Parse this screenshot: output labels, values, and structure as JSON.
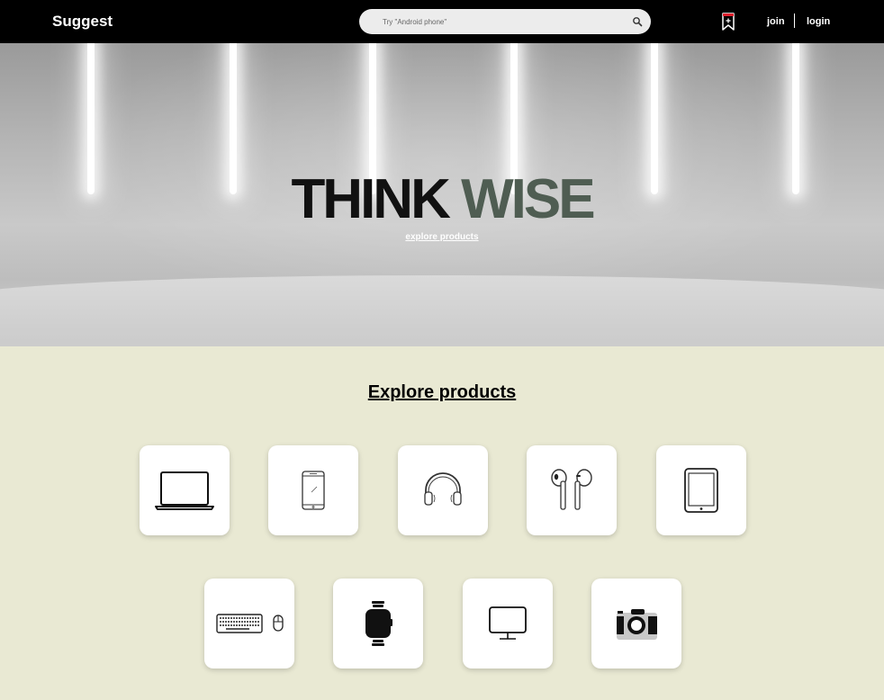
{
  "header": {
    "logo": "Suggest",
    "search": {
      "placeholder": "Try \"Android phone\"",
      "icon": "search-icon"
    },
    "bookmark_icon": "bookmark-icon",
    "join": "join",
    "login": "login"
  },
  "hero": {
    "title_word_1": "THINK",
    "title_word_2": "WISE",
    "link": "explore products",
    "colors": {
      "word_1": "#111111",
      "word_2": "#4f5d52"
    }
  },
  "explore": {
    "title": "Explore products",
    "categories": [
      {
        "icon": "laptop-icon"
      },
      {
        "icon": "smartphone-icon"
      },
      {
        "icon": "headphones-icon"
      },
      {
        "icon": "earbuds-icon"
      },
      {
        "icon": "tablet-icon"
      },
      {
        "icon": "keyboard-mouse-icon"
      },
      {
        "icon": "smartwatch-icon"
      },
      {
        "icon": "monitor-icon"
      },
      {
        "icon": "camera-icon"
      }
    ]
  },
  "colors": {
    "topbar": "#000000",
    "section_bg": "#e9e9d3",
    "card_bg": "#ffffff"
  }
}
